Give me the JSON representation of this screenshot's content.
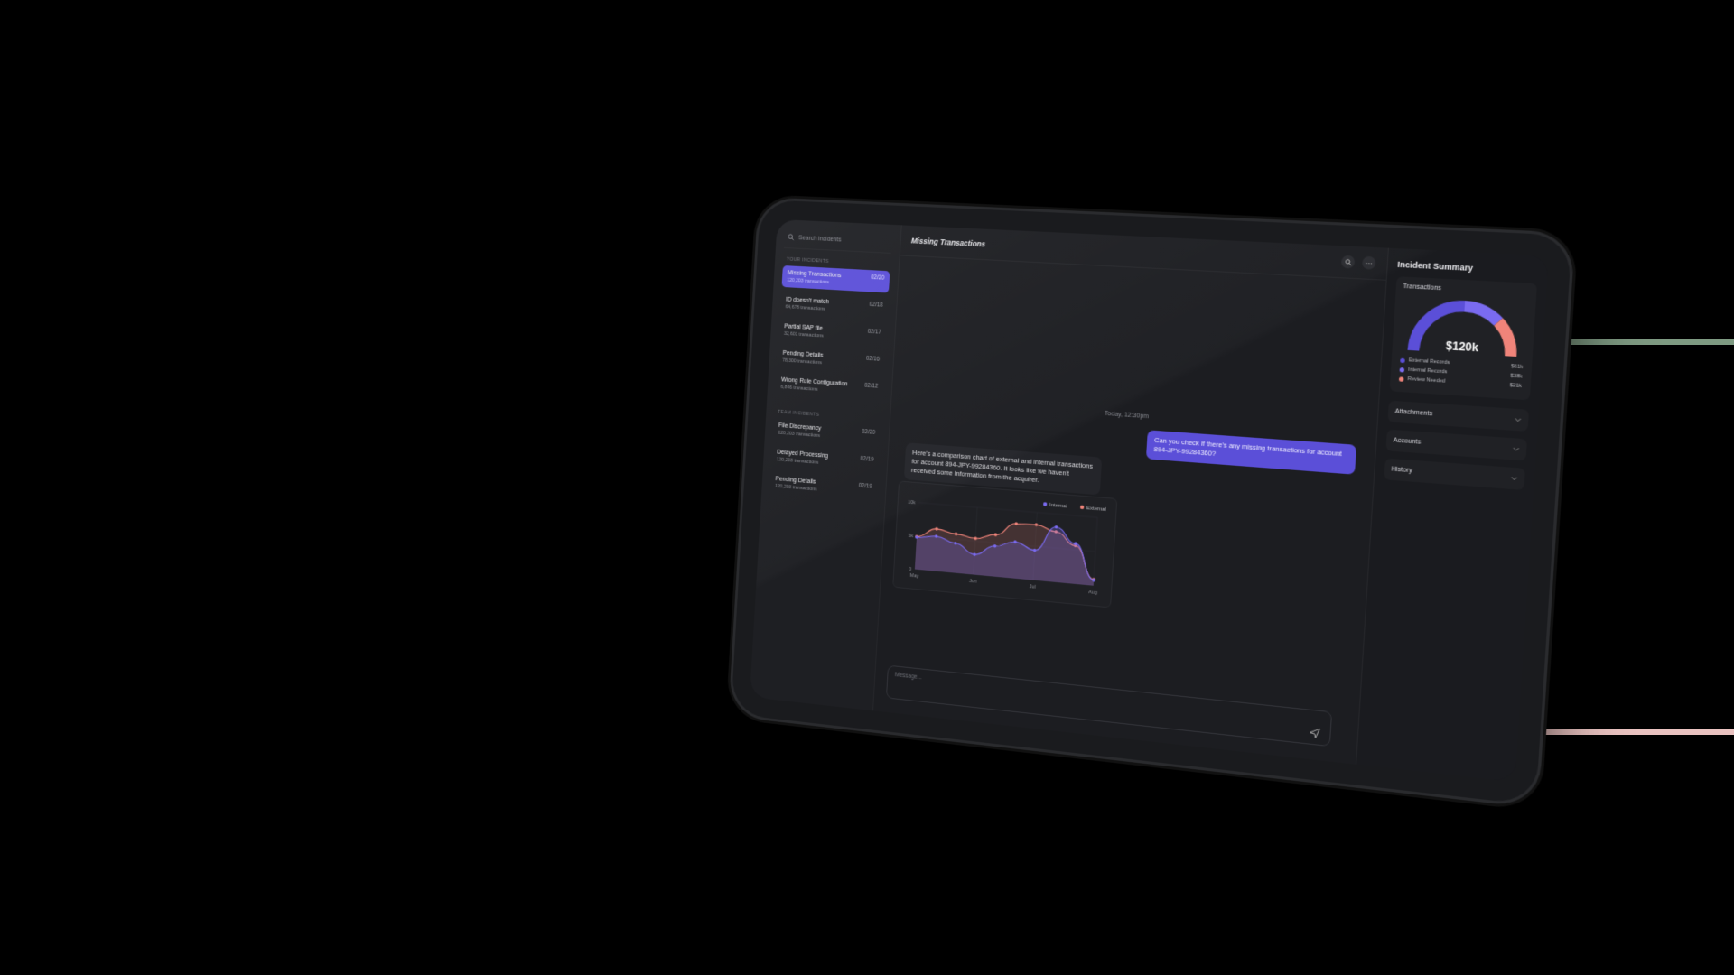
{
  "sidebar": {
    "search_placeholder": "Search incidents",
    "your_label": "YOUR INCIDENTS",
    "team_label": "TEAM INCIDENTS",
    "your_incidents": [
      {
        "title": "Missing Transactions",
        "sub": "120,203 transactions",
        "date": "02/20",
        "active": true
      },
      {
        "title": "ID doesn't match",
        "sub": "64,678 transactions",
        "date": "02/18"
      },
      {
        "title": "Partial SAP file",
        "sub": "32,601 transactions",
        "date": "02/17"
      },
      {
        "title": "Pending Details",
        "sub": "78,300 transactions",
        "date": "02/16"
      },
      {
        "title": "Wrong Rule Configuration",
        "sub": "6,846 transactions",
        "date": "02/12"
      }
    ],
    "team_incidents": [
      {
        "title": "File Discrepancy",
        "sub": "120,203 transactions",
        "date": "02/20"
      },
      {
        "title": "Delayed Processing",
        "sub": "120,203 transactions",
        "date": "02/19"
      },
      {
        "title": "Pending Details",
        "sub": "120,203 transactions",
        "date": "02/19"
      }
    ]
  },
  "main": {
    "title": "Missing Transactions",
    "timestamp": "Today, 12:30pm",
    "user_message": "Can you check if there's any missing transactions for account 894-JPY-99284360?",
    "bot_message": "Here's a comparison chart of external and internal transactions for account 894-JPY-99284360. It looks like we haven't received some information from the acquirer.",
    "composer_placeholder": "Message..."
  },
  "panel": {
    "title": "Incident Summary",
    "transactions_label": "Transactions",
    "total": "$120k",
    "legend": [
      {
        "label": "External Records",
        "value": "$61k",
        "color": "#5b4fd8"
      },
      {
        "label": "Internal Records",
        "value": "$38k",
        "color": "#7a6bf0"
      },
      {
        "label": "Review Needed",
        "value": "$21k",
        "color": "#f0847a"
      }
    ],
    "sections": [
      "Attachments",
      "Accounts",
      "History"
    ]
  },
  "chart_data": {
    "type": "line",
    "x": [
      "May",
      "",
      "Jun",
      "",
      "",
      "Jul",
      "",
      "",
      "Aug",
      ""
    ],
    "xticks": [
      "May",
      "Jun",
      "Jul",
      "Aug"
    ],
    "yticks": [
      "0",
      "5k",
      "10k"
    ],
    "ylim": [
      0,
      10000
    ],
    "series": [
      {
        "name": "Internal",
        "color": "#7a6bf0",
        "values": [
          4800,
          5200,
          4400,
          3000,
          4500,
          5400,
          4400,
          8100,
          5900,
          800
        ]
      },
      {
        "name": "External",
        "color": "#f0847a",
        "values": [
          4900,
          6300,
          5800,
          5400,
          6200,
          8100,
          8200,
          7400,
          5600,
          900
        ]
      }
    ],
    "legend": "top-right"
  }
}
